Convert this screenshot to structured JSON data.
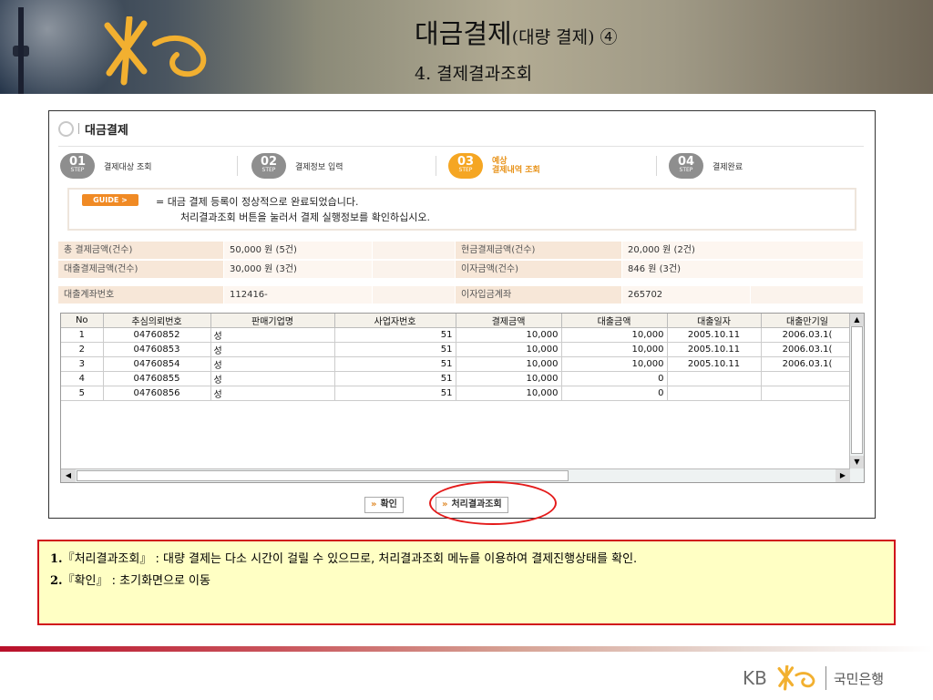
{
  "slide": {
    "title_main": "대금결제",
    "title_sub": "(대량 결제) ④",
    "subtitle": "4. 결제결과조회"
  },
  "page": {
    "heading": "대금결제"
  },
  "steps": [
    {
      "num": "01",
      "step": "STEP",
      "label": "결제대상 조회",
      "active": false
    },
    {
      "num": "02",
      "step": "STEP",
      "label": "결제정보 입력",
      "active": false
    },
    {
      "num": "03",
      "step": "STEP",
      "label_line1": "예상",
      "label_line2": "결제내역 조회",
      "active": true
    },
    {
      "num": "04",
      "step": "STEP",
      "label": "결제완료",
      "active": false
    }
  ],
  "guide": {
    "badge": "GUIDE >",
    "line1": "= 대금 결제 등록이 정상적으로 완료되었습니다.",
    "line2": "처리결과조회 버튼을 눌러서 결제 실행정보를 확인하십시오."
  },
  "summary": {
    "row1": {
      "k1": "총 결제금액(건수)",
      "v1": "50,000 원 (5건)",
      "k2": "현금결제금액(건수)",
      "v2": "20,000 원 (2건)"
    },
    "row2": {
      "k1": "대출결제금액(건수)",
      "v1": "30,000 원 (3건)",
      "k2": "이자금액(건수)",
      "v2": "846 원 (3건)"
    },
    "row3": {
      "k1": "대출계좌번호",
      "v1": "112416-",
      "k2": "이자입금계좌",
      "v2": "265702"
    }
  },
  "table": {
    "headers": [
      "No",
      "추심의뢰번호",
      "판매기업명",
      "사업자번호",
      "결제금액",
      "대출금액",
      "대출일자",
      "대출만기일"
    ],
    "rows": [
      [
        "1",
        "04760852",
        "성",
        "51",
        "10,000",
        "10,000",
        "2005.10.11",
        "2006.03.1("
      ],
      [
        "2",
        "04760853",
        "성",
        "51",
        "10,000",
        "10,000",
        "2005.10.11",
        "2006.03.1("
      ],
      [
        "3",
        "04760854",
        "성",
        "51",
        "10,000",
        "10,000",
        "2005.10.11",
        "2006.03.1("
      ],
      [
        "4",
        "04760855",
        "성",
        "51",
        "10,000",
        "0",
        "",
        ""
      ],
      [
        "5",
        "04760856",
        "성",
        "51",
        "10,000",
        "0",
        "",
        ""
      ]
    ]
  },
  "buttons": {
    "confirm": "확인",
    "result_inquiry": "처리결과조회",
    "arrow": "»"
  },
  "note": {
    "line1_num": "1.",
    "line1_key": "『처리결과조회』",
    "line1_text": ": 대량 결제는 다소 시간이 걸릴 수 있으므로, 처리결과조회 메뉴를 이용하여 결제진행상태를 확인.",
    "line2_num": "2.",
    "line2_key": "『확인』",
    "line2_text": ": 초기화면으로 이동"
  },
  "footer": {
    "kb": "KB",
    "bank_name": "국민은행"
  },
  "colors": {
    "accent_orange": "#f5a623",
    "highlight_red": "#e41b1b",
    "note_bg": "#ffffc4"
  }
}
